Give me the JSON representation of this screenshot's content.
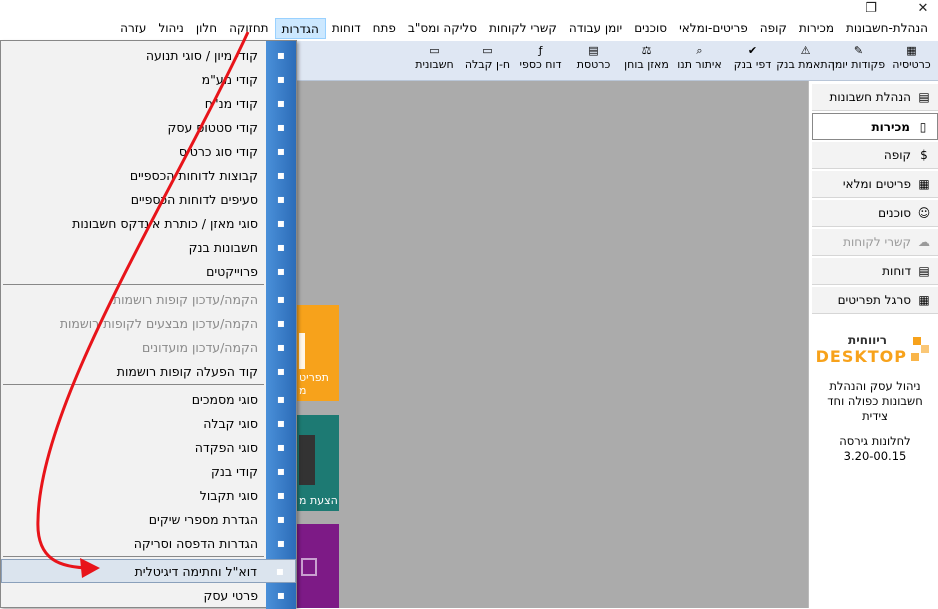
{
  "window": {
    "close": "✕",
    "restore": "❐",
    "minimize": "—"
  },
  "menubar": {
    "items": [
      "הנהלת-חשבונות",
      "מכירות",
      "קופה",
      "פריטים-ומלאי",
      "סוכנים",
      "יומן עבודה",
      "קשרי לקוחות",
      "סליקה ומס\"ב",
      "פתח",
      "דוחות",
      "הגדרות",
      "תחזוקה",
      "חלון",
      "ניהול",
      "עזרה"
    ]
  },
  "toolbar": {
    "buttons": [
      {
        "label": "כרטיסיה",
        "icon": "card-icon"
      },
      {
        "label": "פקודות יומן",
        "icon": "edit-icon"
      },
      {
        "label": "התאמת בנק",
        "icon": "warning-icon"
      },
      {
        "label": "דפי בנק",
        "icon": "check-icon"
      },
      {
        "label": "איתור תנו",
        "icon": "telescope-icon"
      },
      {
        "label": "מאזן בוחן",
        "icon": "balance-icon"
      },
      {
        "label": "כרטסת",
        "icon": "ledger-icon"
      },
      {
        "label": "דוח כספי",
        "icon": "formula-icon"
      },
      {
        "label": "ח-ן קבלה",
        "icon": "receipt-icon"
      },
      {
        "label": "חשבונית",
        "icon": "invoice-icon"
      }
    ]
  },
  "dropdown": {
    "items": [
      {
        "label": "קודי מיון / סוגי תנועה",
        "disabled": false
      },
      {
        "label": "קודי מע\"מ",
        "disabled": false
      },
      {
        "label": "קודי מנ\"ח",
        "disabled": false
      },
      {
        "label": "קודי סטטוס עסק",
        "disabled": false
      },
      {
        "label": "קודי סוג כרטיס",
        "disabled": false
      },
      {
        "label": "קבוצות לדוחות הכספיים",
        "disabled": false
      },
      {
        "label": "סעיפים לדוחות הכספיים",
        "disabled": false
      },
      {
        "label": "סוגי מאזן / כותרת אינדקס חשבונות",
        "disabled": false
      },
      {
        "label": "חשבונות בנק",
        "disabled": false
      },
      {
        "label": "פרוייקטים",
        "disabled": false
      },
      {
        "label": "הקמה/עדכון קופות רושמות",
        "disabled": true
      },
      {
        "label": "הקמה/עדכון מבצעים לקופות רושמות",
        "disabled": true
      },
      {
        "label": "הקמה/עדכון מועדונים",
        "disabled": true
      },
      {
        "label": "קוד הפעלה קופות רושמות",
        "disabled": false
      },
      {
        "label": "סוגי מסמכים",
        "disabled": false
      },
      {
        "label": "סוגי קבלה",
        "disabled": false
      },
      {
        "label": "סוגי הפקדה",
        "disabled": false
      },
      {
        "label": "קודי בנק",
        "disabled": false
      },
      {
        "label": "סוגי תקבול",
        "disabled": false
      },
      {
        "label": "הגדרת מספרי שיקים",
        "disabled": false
      },
      {
        "label": "הגדרות הדפסה וסריקה",
        "disabled": false
      },
      {
        "label": "דוא\"ל וחתימה דיגיטלית",
        "disabled": false,
        "highlight": true
      },
      {
        "label": "פרטי עסק",
        "disabled": false
      }
    ]
  },
  "tiles": [
    {
      "label": "תפריט מ",
      "color": "#f7a21b"
    },
    {
      "label": "הצעת מ",
      "color": "#1d7a73"
    },
    {
      "label": "",
      "color": "#7d1a86"
    }
  ],
  "rightpanel": {
    "items": [
      {
        "label": "הנהלת חשבונות",
        "selected": false,
        "disabled": false
      },
      {
        "label": "מכירות",
        "selected": true,
        "disabled": false
      },
      {
        "label": "קופה",
        "selected": false,
        "disabled": false
      },
      {
        "label": "פריטים ומלאי",
        "selected": false,
        "disabled": false
      },
      {
        "label": "סוכנים",
        "selected": false,
        "disabled": false
      },
      {
        "label": "קשרי לקוחות",
        "selected": false,
        "disabled": true
      },
      {
        "label": "דוחות",
        "selected": false,
        "disabled": false
      },
      {
        "label": "סרגל תפריטים",
        "selected": false,
        "disabled": false
      }
    ],
    "brand": {
      "logo_top": "ריווחית",
      "logo_bottom": "DESKTOP",
      "line1": "ניהול עסק והנהלת",
      "line2": "חשבונות כפולה וחד צידית",
      "line3": "לחלונות גירסה",
      "version": "3.20-00.15"
    }
  },
  "colors": {
    "accent": "#2c6cb8",
    "arrow": "#e8141a",
    "orange": "#f7a21b"
  }
}
